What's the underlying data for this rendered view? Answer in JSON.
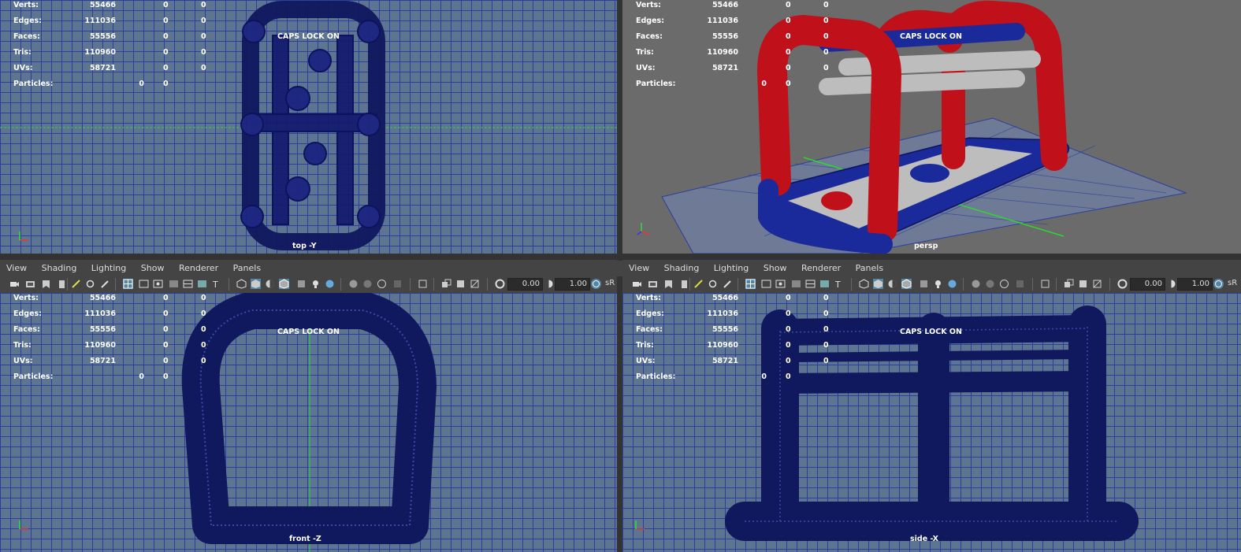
{
  "hud_labels": {
    "verts": "Verts:",
    "edges": "Edges:",
    "faces": "Faces:",
    "tris": "Tris:",
    "uvs": "UVs:",
    "particles": "Particles:"
  },
  "stats": {
    "verts": [
      "55466",
      "0",
      "0"
    ],
    "edges": [
      "111036",
      "0",
      "0"
    ],
    "faces": [
      "55556",
      "0",
      "0"
    ],
    "tris": [
      "110960",
      "0",
      "0"
    ],
    "uvs": [
      "58721",
      "0",
      "0"
    ],
    "particles": [
      "0",
      "0"
    ]
  },
  "caps_lock": "CAPS LOCK ON",
  "viewports": {
    "top": {
      "name": "top -Y"
    },
    "persp": {
      "name": "persp"
    },
    "front": {
      "name": "front -Z"
    },
    "side": {
      "name": "side -X"
    }
  },
  "panel_menu": [
    "View",
    "Shading",
    "Lighting",
    "Show",
    "Renderer",
    "Panels"
  ],
  "toolbar": {
    "exposure": "0.00",
    "gamma": "1.00",
    "srgb": "sR"
  },
  "colors": {
    "grid_bg": "#5d7591",
    "grid_line": "#2a3f9e",
    "wire": "#10185e",
    "persp_red": "#c0101a",
    "persp_blue": "#1a2a9a",
    "persp_grey": "#bdbdbd"
  },
  "icons": [
    "camera-icon",
    "film-icon",
    "bookmark-icon",
    "grid-icon",
    "wireframe-icon",
    "shaded-icon",
    "light-icon",
    "texture-icon",
    "isolate-icon",
    "xray-icon",
    "exposure-icon",
    "gamma-icon",
    "color-management-icon"
  ]
}
